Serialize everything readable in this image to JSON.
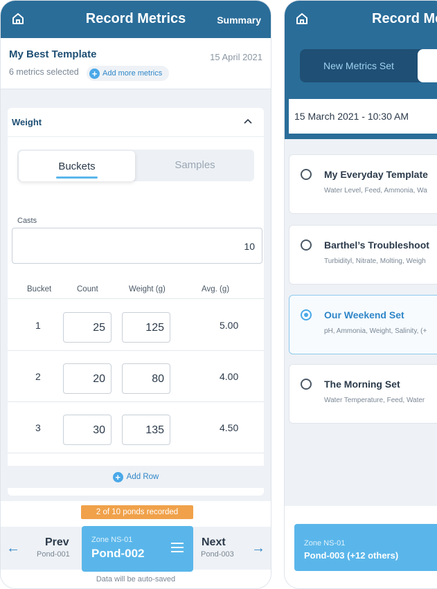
{
  "left": {
    "header": {
      "title": "Record Metrics",
      "summary_label": "Summary",
      "home_icon": "home-icon"
    },
    "template": {
      "name": "My Best Template",
      "date": "15 April 2021",
      "metrics_count": "6 metrics selected",
      "add_metrics_label": "Add more metrics"
    },
    "weight_card": {
      "title": "Weight",
      "tabs": [
        {
          "label": "Buckets",
          "active": true
        },
        {
          "label": "Samples",
          "active": false
        }
      ],
      "casts_label": "Casts",
      "casts_value": "10",
      "columns": [
        "Bucket",
        "Count",
        "Weight (g)",
        "Avg. (g)"
      ],
      "rows": [
        {
          "bucket": "1",
          "count": "25",
          "weight": "125",
          "avg": "5.00"
        },
        {
          "bucket": "2",
          "count": "20",
          "weight": "80",
          "avg": "4.00"
        },
        {
          "bucket": "3",
          "count": "30",
          "weight": "135",
          "avg": "4.50"
        }
      ],
      "add_row_label": "Add Row"
    },
    "footer": {
      "recorded_badge": "2 of 10 ponds recorded",
      "prev_label": "Prev",
      "prev_pond": "Pond-001",
      "zone": "Zone NS-01",
      "current_pond": "Pond-002",
      "next_label": "Next",
      "next_pond": "Pond-003",
      "autosave_note": "Data will be auto-saved"
    }
  },
  "right": {
    "header": {
      "title": "Record Me"
    },
    "toggle": {
      "new_label": "New Metrics Set"
    },
    "date_time": "15 March 2021 - 10:30 AM",
    "sets": [
      {
        "name": "My Everyday Template",
        "metrics": "Water Level, Feed, Ammonia, Wa",
        "selected": false
      },
      {
        "name": "Barthel’s Troubleshoot",
        "metrics": "Turbidityl, Nitrate, Molting, Weigh",
        "selected": false
      },
      {
        "name": "Our Weekend Set",
        "metrics": "pH, Ammonia, Weight, Salinity, (+",
        "selected": true
      },
      {
        "name": "The Morning Set",
        "metrics": "Water Temperature, Feed, Water",
        "selected": false
      }
    ],
    "footer": {
      "zone": "Zone NS-01",
      "pond": "Pond-003 (+12 others)"
    }
  },
  "colors": {
    "header": "#2a6d99",
    "accent": "#5ab6ea",
    "badge": "#f0a14a",
    "link": "#2f86c8"
  }
}
